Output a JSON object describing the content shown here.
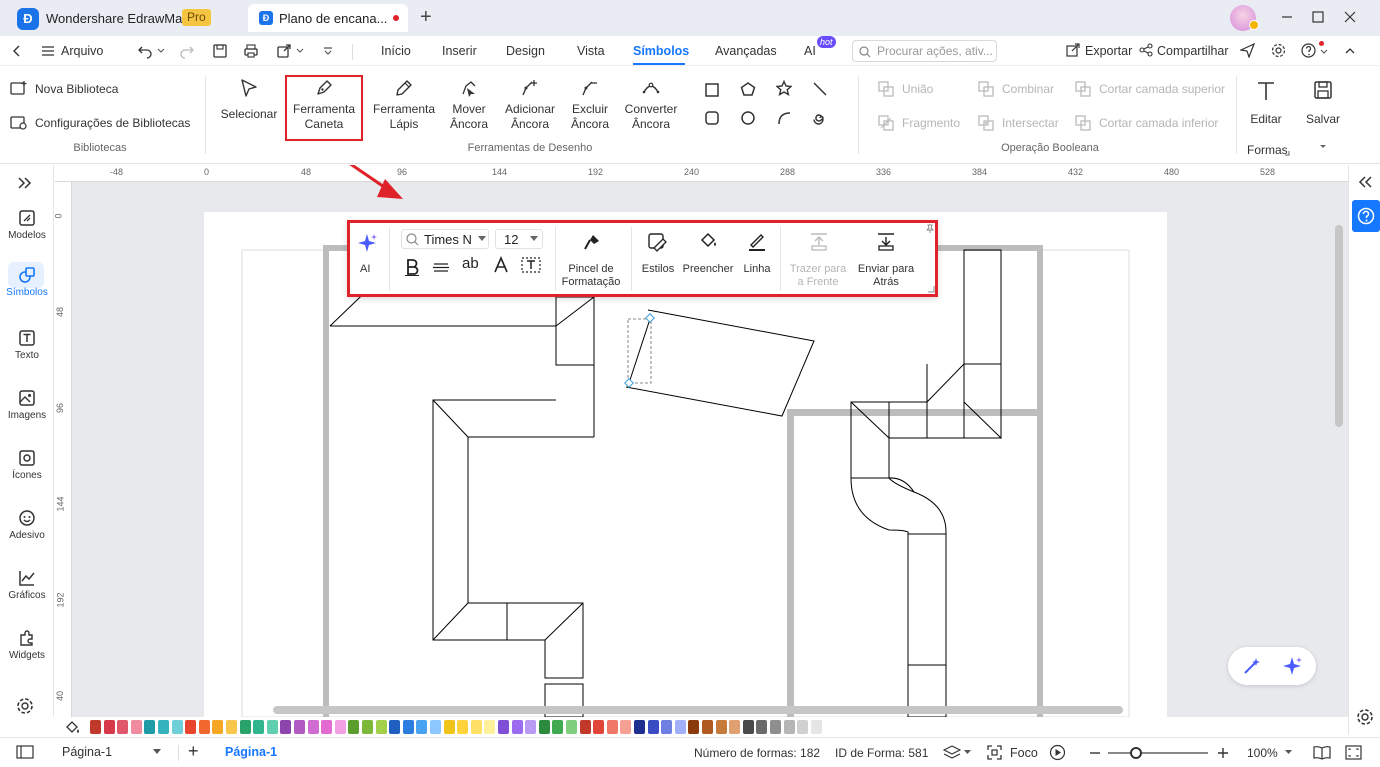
{
  "titlebar": {
    "app_name": "Wondershare EdrawMax",
    "pro_badge": "Pro",
    "doc_tab": "Plano de encana...",
    "add_tab": "+"
  },
  "menubar": {
    "file": "Arquivo",
    "tabs": [
      "Início",
      "Inserir",
      "Design",
      "Vista",
      "Símbolos",
      "Avançadas",
      "AI"
    ],
    "hot_badge": "hot",
    "search_placeholder": "Procurar ações, ativ...",
    "export": "Exportar",
    "share": "Compartilhar"
  },
  "ribbon": {
    "new_library": "Nova Biblioteca",
    "library_settings": "Configurações de Bibliotecas",
    "group_libraries": "Bibliotecas",
    "select": "Selecionar",
    "pen_tool": "Ferramenta\nCaneta",
    "pencil_tool": "Ferramenta\nLápis",
    "move_anchor": "Mover\nÂncora",
    "add_anchor": "Adicionar\nÂncora",
    "delete_anchor": "Excluir\nÂncora",
    "convert_anchor": "Converter\nÂncora",
    "group_drawing": "Ferramentas de Desenho",
    "union": "União",
    "combine": "Combinar",
    "cut_top": "Cortar camada superior",
    "fragment": "Fragmento",
    "intersect": "Intersectar",
    "cut_bottom": "Cortar camada inferior",
    "group_boolean": "Operação Booleana",
    "edit_label": "Editar",
    "shapes_label": "Formas",
    "save": "Salvar"
  },
  "leftbar": {
    "items": [
      "Modelos",
      "Símbolos",
      "Texto",
      "Imagens",
      "Ícones",
      "Adesivo",
      "Gráficos",
      "Widgets"
    ]
  },
  "rulers": {
    "top": [
      "-48",
      "0",
      "48",
      "96",
      "144",
      "192",
      "240",
      "288",
      "336",
      "384",
      "432",
      "480",
      "528"
    ],
    "left": [
      "0",
      "48",
      "96",
      "144",
      "192",
      "40"
    ]
  },
  "floating_toolbar": {
    "ai": "AI",
    "font": "Times N",
    "size": "12",
    "format_painter": "Pincel de\nFormatação",
    "styles": "Estilos",
    "fill": "Preencher",
    "line": "Linha",
    "bring_front": "Trazer para\na Frente",
    "send_back": "Enviar para\nAtrás"
  },
  "statusbar": {
    "page_select": "Página-1",
    "page_tab": "Página-1",
    "shape_count": "Número de formas: 182",
    "shape_id": "ID de Forma: 581",
    "focus": "Foco",
    "zoom": "100%"
  },
  "colors": {
    "accent": "#1677ff",
    "highlight_red": "#e0232a",
    "palette": [
      "#c0392b",
      "#d63a4a",
      "#e0566b",
      "#f08ca0",
      "#1e9ba5",
      "#33b3bd",
      "#6fd0d8",
      "#e8442e",
      "#f0682e",
      "#f5a623",
      "#f7c64a",
      "#2aa36b",
      "#30b58d",
      "#5fcfb0",
      "#8e44ad",
      "#b05ac2",
      "#d06bd2",
      "#e36ad0",
      "#f2a0e3",
      "#5b9e2e",
      "#7cb83a",
      "#a2d04a",
      "#1f5fbf",
      "#2d7de0",
      "#4aa3f0",
      "#8cc8ff",
      "#f0c419",
      "#ffd43b",
      "#ffe066",
      "#fff09a",
      "#7f4fd6",
      "#9b6cf0",
      "#b99af5",
      "#2b8a3e",
      "#3faa4f",
      "#7fcf7f",
      "#c0392b",
      "#e0453a",
      "#f07866",
      "#f5a092",
      "#1f2f8f",
      "#3a4cc4",
      "#6d7fe0",
      "#a2affa",
      "#8a3a0c",
      "#b05a1f",
      "#c77b3a",
      "#e0a070",
      "#4a4a4a",
      "#6a6a6a",
      "#8e8e8e",
      "#b5b5b5",
      "#d0d0d0",
      "#e5e5e5"
    ]
  }
}
